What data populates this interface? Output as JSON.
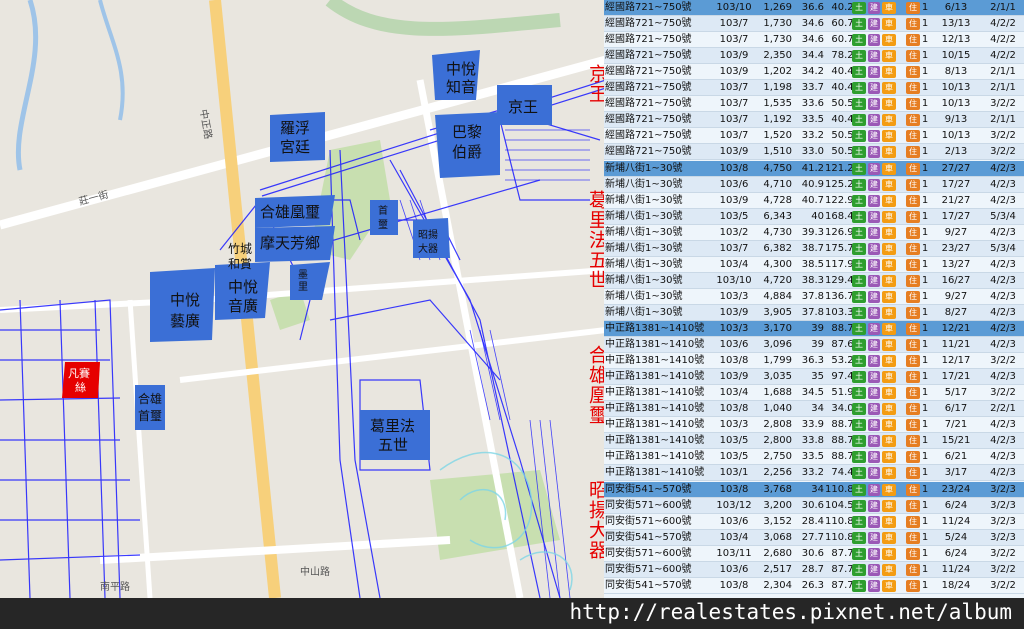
{
  "map": {
    "labels": {
      "zhongyue_zhiyin": [
        "中悅",
        "知音"
      ],
      "jingwang": "京王",
      "luofu_gongting": [
        "羅浮",
        "宮廷"
      ],
      "bali_bojue": [
        "巴黎",
        "伯爵"
      ],
      "hexiong_huangxi": "合雄凰璽",
      "motian_fangzhong": "摩天芳鄉",
      "zhucheng_heshang": [
        "竹城",
        "和賞"
      ],
      "zhongyue_yinguang": [
        "中悅",
        "音廣"
      ],
      "zhongyue_yiguang": [
        "中悅",
        "藝廣"
      ],
      "fansaisi": [
        "凡賽",
        "絲"
      ],
      "hexiong_shoulu": [
        "合雄",
        "首璽"
      ],
      "gelifa_wushi": [
        "葛里法",
        "五世"
      ],
      "zhaoyang_daqi": [
        "昭揚",
        "大器"
      ],
      "small_a": [
        "首",
        "璽"
      ],
      "small_b": [
        "墨",
        "里",
        "芬"
      ]
    },
    "streets": [
      "中正路",
      "莊一街",
      "南平路",
      "中山路"
    ],
    "colors": {
      "parcel": "#3b6fd6",
      "redParcel": "#e60000",
      "line": "#1a1aff",
      "road": "#ffffff",
      "arterial": "#f7d07b"
    }
  },
  "side_labels": {
    "l1": "京王",
    "l2": "葛里法五世",
    "l3": "合雄凰璽",
    "l4": "昭揚大器"
  },
  "table": {
    "rows": [
      {
        "addr": "經國路721~750號",
        "date": "103/10",
        "price": "1,269",
        "unit": "36.6",
        "area": "40.28",
        "b": [
          "土",
          "建",
          "車",
          "住"
        ],
        "n": "1",
        "floor": "6/13",
        "lay": "2/1/1",
        "h": true
      },
      {
        "addr": "經國路721~750號",
        "date": "103/7",
        "price": "1,730",
        "unit": "34.6",
        "area": "60.71",
        "b": [
          "土",
          "建",
          "車",
          "住"
        ],
        "n": "1",
        "floor": "13/13",
        "lay": "4/2/2"
      },
      {
        "addr": "經國路721~750號",
        "date": "103/7",
        "price": "1,730",
        "unit": "34.6",
        "area": "60.71",
        "b": [
          "土",
          "建",
          "車",
          "住"
        ],
        "n": "1",
        "floor": "12/13",
        "lay": "4/2/2"
      },
      {
        "addr": "經國路721~750號",
        "date": "103/9",
        "price": "2,350",
        "unit": "34.4",
        "area": "78.29",
        "b": [
          "土",
          "建",
          "車",
          "住"
        ],
        "n": "1",
        "floor": "10/15",
        "lay": "4/2/2"
      },
      {
        "addr": "經國路721~750號",
        "date": "103/9",
        "price": "1,202",
        "unit": "34.2",
        "area": "40.46",
        "b": [
          "土",
          "建",
          "車",
          "住"
        ],
        "n": "1",
        "floor": "8/13",
        "lay": "2/1/1"
      },
      {
        "addr": "經國路721~750號",
        "date": "103/7",
        "price": "1,198",
        "unit": "33.7",
        "area": "40.46",
        "b": [
          "土",
          "建",
          "車",
          "住"
        ],
        "n": "1",
        "floor": "10/13",
        "lay": "2/1/1"
      },
      {
        "addr": "經國路721~750號",
        "date": "103/7",
        "price": "1,535",
        "unit": "33.6",
        "area": "50.54",
        "b": [
          "土",
          "建",
          "車",
          "住"
        ],
        "n": "1",
        "floor": "10/13",
        "lay": "3/2/2"
      },
      {
        "addr": "經國路721~750號",
        "date": "103/7",
        "price": "1,192",
        "unit": "33.5",
        "area": "40.46",
        "b": [
          "土",
          "建",
          "車",
          "住"
        ],
        "n": "1",
        "floor": "9/13",
        "lay": "2/1/1"
      },
      {
        "addr": "經國路721~750號",
        "date": "103/7",
        "price": "1,520",
        "unit": "33.2",
        "area": "50.54",
        "b": [
          "土",
          "建",
          "車",
          "住"
        ],
        "n": "1",
        "floor": "10/13",
        "lay": "3/2/2"
      },
      {
        "addr": "經國路721~750號",
        "date": "103/9",
        "price": "1,510",
        "unit": "33.0",
        "area": "50.54",
        "b": [
          "土",
          "建",
          "車",
          "住"
        ],
        "n": "1",
        "floor": "2/13",
        "lay": "3/2/2"
      },
      {
        "addr": "新埔八街1~30號",
        "date": "103/8",
        "price": "4,750",
        "unit": "41.2",
        "area": "121.25",
        "b": [
          "土",
          "建",
          "車",
          "住"
        ],
        "n": "1",
        "floor": "27/27",
        "lay": "4/2/3",
        "h": true
      },
      {
        "addr": "新埔八街1~30號",
        "date": "103/6",
        "price": "4,710",
        "unit": "40.9",
        "area": "125.24",
        "b": [
          "土",
          "建",
          "車",
          "住"
        ],
        "n": "1",
        "floor": "17/27",
        "lay": "4/2/3"
      },
      {
        "addr": "新埔八街1~30號",
        "date": "103/9",
        "price": "4,728",
        "unit": "40.7",
        "area": "122.91",
        "b": [
          "土",
          "建",
          "車",
          "住"
        ],
        "n": "1",
        "floor": "21/27",
        "lay": "4/2/3"
      },
      {
        "addr": "新埔八街1~30號",
        "date": "103/5",
        "price": "6,343",
        "unit": "40",
        "area": "168.47",
        "b": [
          "土",
          "建",
          "車",
          "住"
        ],
        "n": "1",
        "floor": "17/27",
        "lay": "5/3/4"
      },
      {
        "addr": "新埔八街1~30號",
        "date": "103/2",
        "price": "4,730",
        "unit": "39.3",
        "area": "126.90",
        "b": [
          "土",
          "建",
          "車",
          "住"
        ],
        "n": "1",
        "floor": "9/27",
        "lay": "4/2/3"
      },
      {
        "addr": "新埔八街1~30號",
        "date": "103/7",
        "price": "6,382",
        "unit": "38.7",
        "area": "175.77",
        "b": [
          "土",
          "建",
          "車",
          "住"
        ],
        "n": "1",
        "floor": "23/27",
        "lay": "5/3/4"
      },
      {
        "addr": "新埔八街1~30號",
        "date": "103/4",
        "price": "4,300",
        "unit": "38.5",
        "area": "117.93",
        "b": [
          "土",
          "建",
          "車",
          "住"
        ],
        "n": "1",
        "floor": "13/27",
        "lay": "4/2/3"
      },
      {
        "addr": "新埔八街1~30號",
        "date": "103/10",
        "price": "4,720",
        "unit": "38.3",
        "area": "129.42",
        "b": [
          "土",
          "建",
          "車",
          "住"
        ],
        "n": "1",
        "floor": "16/27",
        "lay": "4/2/3"
      },
      {
        "addr": "新埔八街1~30號",
        "date": "103/3",
        "price": "4,884",
        "unit": "37.8",
        "area": "136.73",
        "b": [
          "土",
          "建",
          "車",
          "住"
        ],
        "n": "1",
        "floor": "9/27",
        "lay": "4/2/3"
      },
      {
        "addr": "新埔八街1~30號",
        "date": "103/9",
        "price": "3,905",
        "unit": "37.8",
        "area": "103.32",
        "b": [
          "土",
          "建",
          "車",
          "住"
        ],
        "n": "1",
        "floor": "8/27",
        "lay": "4/2/3"
      },
      {
        "addr": "中正路1381~1410號",
        "date": "103/3",
        "price": "3,170",
        "unit": "39",
        "area": "88.72",
        "b": [
          "土",
          "建",
          "車",
          "住"
        ],
        "n": "1",
        "floor": "12/21",
        "lay": "4/2/3",
        "h": true
      },
      {
        "addr": "中正路1381~1410號",
        "date": "103/6",
        "price": "3,096",
        "unit": "39",
        "area": "87.62",
        "b": [
          "土",
          "建",
          "車",
          "住"
        ],
        "n": "1",
        "floor": "11/21",
        "lay": "4/2/3"
      },
      {
        "addr": "中正路1381~1410號",
        "date": "103/8",
        "price": "1,799",
        "unit": "36.3",
        "area": "53.27",
        "b": [
          "土",
          "建",
          "車",
          "住"
        ],
        "n": "1",
        "floor": "12/17",
        "lay": "3/2/2"
      },
      {
        "addr": "中正路1381~1410號",
        "date": "103/9",
        "price": "3,035",
        "unit": "35",
        "area": "97.44",
        "b": [
          "土",
          "建",
          "車",
          "住"
        ],
        "n": "1",
        "floor": "17/21",
        "lay": "4/2/3"
      },
      {
        "addr": "中正路1381~1410號",
        "date": "103/4",
        "price": "1,688",
        "unit": "34.5",
        "area": "51.91",
        "b": [
          "土",
          "建",
          "車",
          "住"
        ],
        "n": "1",
        "floor": "5/17",
        "lay": "3/2/2"
      },
      {
        "addr": "中正路1381~1410號",
        "date": "103/8",
        "price": "1,040",
        "unit": "34",
        "area": "34.03",
        "b": [
          "土",
          "建",
          "車",
          "住"
        ],
        "n": "1",
        "floor": "6/17",
        "lay": "2/2/1"
      },
      {
        "addr": "中正路1381~1410號",
        "date": "103/3",
        "price": "2,808",
        "unit": "33.9",
        "area": "88.72",
        "b": [
          "土",
          "建",
          "車",
          "住"
        ],
        "n": "1",
        "floor": "7/21",
        "lay": "4/2/3"
      },
      {
        "addr": "中正路1381~1410號",
        "date": "103/5",
        "price": "2,800",
        "unit": "33.8",
        "area": "88.72",
        "b": [
          "土",
          "建",
          "車",
          "住"
        ],
        "n": "1",
        "floor": "15/21",
        "lay": "4/2/3"
      },
      {
        "addr": "中正路1381~1410號",
        "date": "103/5",
        "price": "2,750",
        "unit": "33.5",
        "area": "88.72",
        "b": [
          "土",
          "建",
          "車",
          "住"
        ],
        "n": "1",
        "floor": "6/21",
        "lay": "4/2/3"
      },
      {
        "addr": "中正路1381~1410號",
        "date": "103/1",
        "price": "2,256",
        "unit": "33.2",
        "area": "74.48",
        "b": [
          "土",
          "建",
          "車",
          "住"
        ],
        "n": "1",
        "floor": "3/17",
        "lay": "4/2/3"
      },
      {
        "addr": "同安街541~570號",
        "date": "103/8",
        "price": "3,768",
        "unit": "34",
        "area": "110.89",
        "b": [
          "土",
          "建",
          "車",
          "住"
        ],
        "n": "1",
        "floor": "23/24",
        "lay": "3/2/3",
        "h": true
      },
      {
        "addr": "同安街571~600號",
        "date": "103/12",
        "price": "3,200",
        "unit": "30.6",
        "area": "104.50",
        "b": [
          "土",
          "建",
          "車",
          "住"
        ],
        "n": "1",
        "floor": "6/24",
        "lay": "3/2/3"
      },
      {
        "addr": "同安街571~600號",
        "date": "103/6",
        "price": "3,152",
        "unit": "28.4",
        "area": "110.89",
        "b": [
          "土",
          "建",
          "車",
          "住"
        ],
        "n": "1",
        "floor": "11/24",
        "lay": "3/2/3"
      },
      {
        "addr": "同安街541~570號",
        "date": "103/4",
        "price": "3,068",
        "unit": "27.7",
        "area": "110.89",
        "b": [
          "土",
          "建",
          "車",
          "住"
        ],
        "n": "1",
        "floor": "5/24",
        "lay": "3/2/3"
      },
      {
        "addr": "同安街571~600號",
        "date": "103/11",
        "price": "2,680",
        "unit": "30.6",
        "area": "87.70",
        "b": [
          "土",
          "建",
          "車",
          "住"
        ],
        "n": "1",
        "floor": "6/24",
        "lay": "3/2/2"
      },
      {
        "addr": "同安街571~600號",
        "date": "103/6",
        "price": "2,517",
        "unit": "28.7",
        "area": "87.70",
        "b": [
          "土",
          "建",
          "車",
          "住"
        ],
        "n": "1",
        "floor": "11/24",
        "lay": "3/2/2"
      },
      {
        "addr": "同安街541~570號",
        "date": "103/8",
        "price": "2,304",
        "unit": "26.3",
        "area": "87.70",
        "b": [
          "土",
          "建",
          "車",
          "住"
        ],
        "n": "1",
        "floor": "18/24",
        "lay": "3/2/2"
      }
    ]
  },
  "footer": {
    "url": "http://realestates.pixnet.net/album"
  }
}
